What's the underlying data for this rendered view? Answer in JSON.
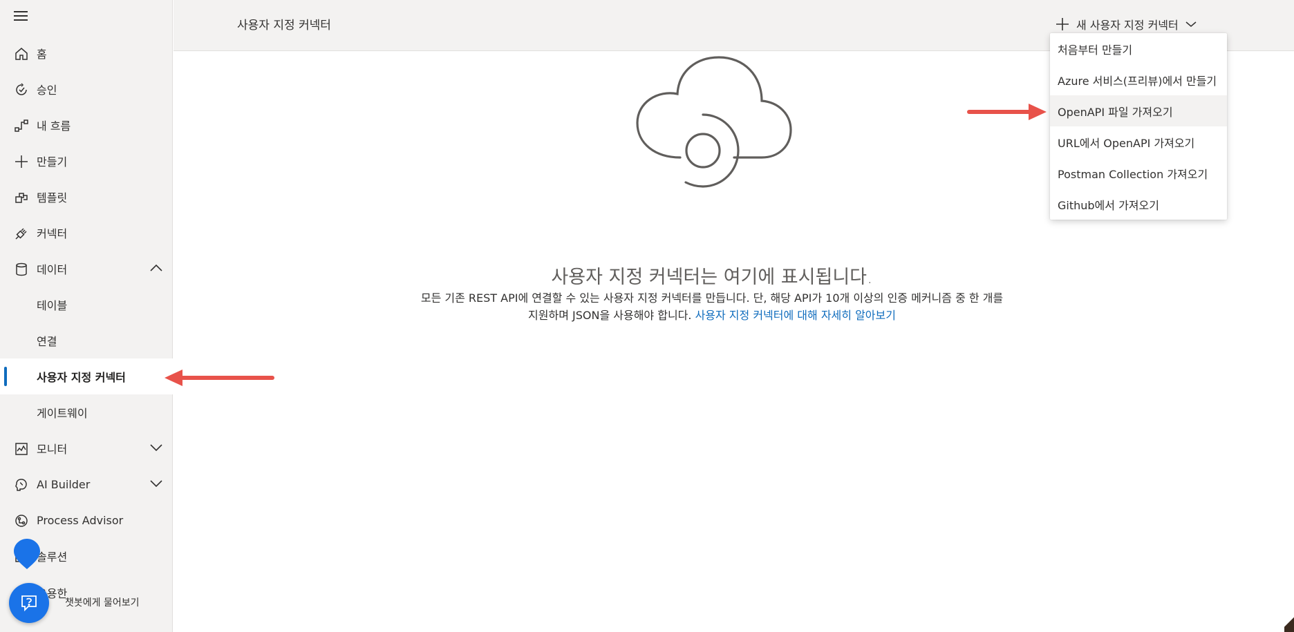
{
  "sidebar": {
    "items": [
      {
        "label": "홈",
        "icon": "home-icon"
      },
      {
        "label": "승인",
        "icon": "approvals-icon"
      },
      {
        "label": "내 흐름",
        "icon": "flows-icon"
      },
      {
        "label": "만들기",
        "icon": "plus-icon"
      },
      {
        "label": "템플릿",
        "icon": "templates-icon"
      },
      {
        "label": "커넥터",
        "icon": "connector-plug-icon"
      },
      {
        "label": "데이터",
        "icon": "database-icon",
        "expanded": true
      },
      {
        "label": "테이블"
      },
      {
        "label": "연결"
      },
      {
        "label": "사용자 지정 커넥터",
        "active": true
      },
      {
        "label": "게이트웨이"
      },
      {
        "label": "모니터",
        "icon": "monitor-icon",
        "expanded": false
      },
      {
        "label": "AI Builder",
        "icon": "ai-builder-icon",
        "expanded": false
      },
      {
        "label": "Process Advisor",
        "icon": "process-advisor-icon"
      },
      {
        "label": "솔루션",
        "icon": "solutions-icon"
      }
    ],
    "peek_label": "유용한"
  },
  "header": {
    "title": "사용자 지정 커넥터",
    "new_button_label": "새 사용자 지정 커넥터"
  },
  "dropdown": {
    "items": [
      "처음부터 만들기",
      "Azure 서비스(프리뷰)에서 만들기",
      "OpenAPI 파일 가져오기",
      "URL에서 OpenAPI 가져오기",
      "Postman Collection 가져오기",
      "Github에서 가져오기"
    ],
    "highlighted_index": 2
  },
  "empty_state": {
    "title": "사용자 지정 커넥터는 여기에 표시됩니다.",
    "description": "모든 기존 REST API에 연결할 수 있는 사용자 지정 커넥터를 만듭니다. 단, 해당 API가 10개 이상의 인증 메커니즘 중 한 개를 지원하며 JSON을 사용해야 합니다.",
    "link": "사용자 지정 커넥터에 대해 자세히 알아보기"
  },
  "chat": {
    "label": "챗봇에게 물어보기"
  },
  "colors": {
    "accent": "#0f6cbd",
    "annotation_arrow": "#e8524a",
    "chat_button": "#1a73e8"
  }
}
